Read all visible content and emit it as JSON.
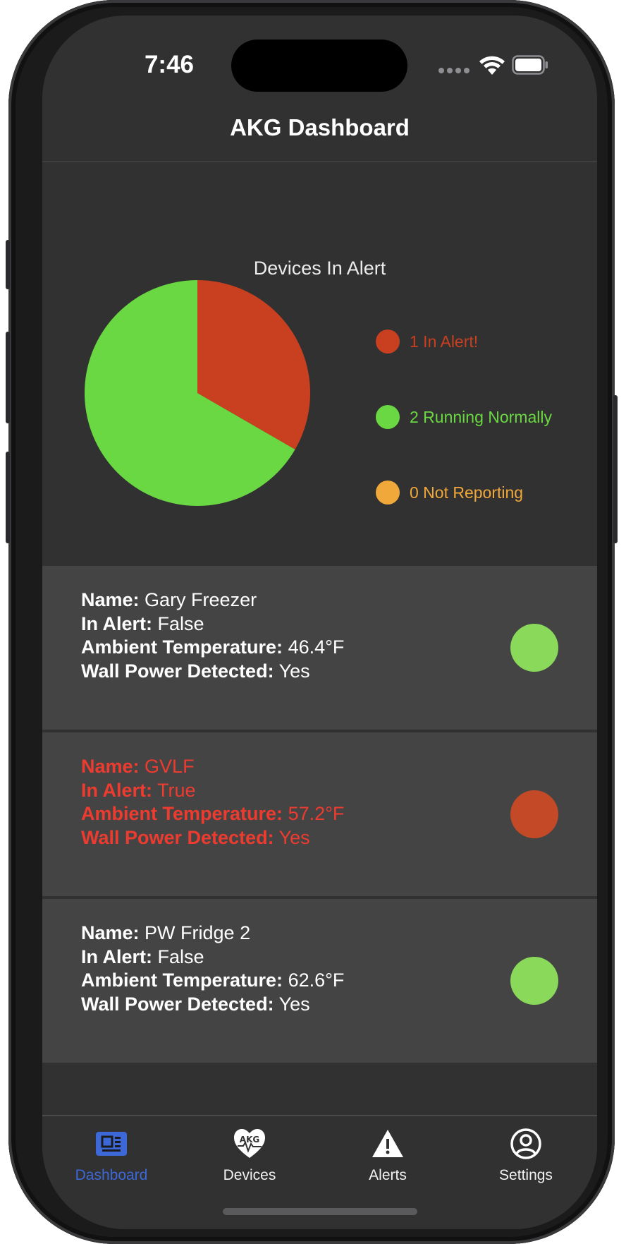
{
  "status_bar": {
    "time": "7:46"
  },
  "nav": {
    "title": "AKG Dashboard"
  },
  "chart_data": {
    "type": "pie",
    "title": "Devices In Alert",
    "slices": [
      {
        "label": "1 In Alert!",
        "value": 1,
        "color": "#c8401f"
      },
      {
        "label": "2 Running Normally",
        "value": 2,
        "color": "#6ad842"
      },
      {
        "label": "0 Not Reporting",
        "value": 0,
        "color": "#f1a83a"
      }
    ]
  },
  "device_field_labels": {
    "name": "Name:",
    "in_alert": "In Alert:",
    "ambient_temperature": "Ambient Temperature:",
    "wall_power": "Wall Power Detected:"
  },
  "devices": [
    {
      "name": "Gary Freezer",
      "in_alert": "False",
      "ambient_temperature": "46.4°F",
      "wall_power": "Yes",
      "status_color": "#8ad95a"
    },
    {
      "name": "GVLF",
      "in_alert": "True",
      "ambient_temperature": "57.2°F",
      "wall_power": "Yes",
      "status_color": "#c44a27"
    },
    {
      "name": "PW Fridge 2",
      "in_alert": "False",
      "ambient_temperature": "62.6°F",
      "wall_power": "Yes",
      "status_color": "#8ad95a"
    }
  ],
  "tabs": [
    {
      "label": "Dashboard",
      "icon": "dashboard-icon",
      "active": true
    },
    {
      "label": "Devices",
      "icon": "akg-heart-icon",
      "active": false
    },
    {
      "label": "Alerts",
      "icon": "warning-icon",
      "active": false
    },
    {
      "label": "Settings",
      "icon": "user-circle-icon",
      "active": false
    }
  ],
  "colors": {
    "accent": "#3d68d8",
    "background": "#313131",
    "card": "#444444",
    "alert_text": "#ee3b2f"
  }
}
